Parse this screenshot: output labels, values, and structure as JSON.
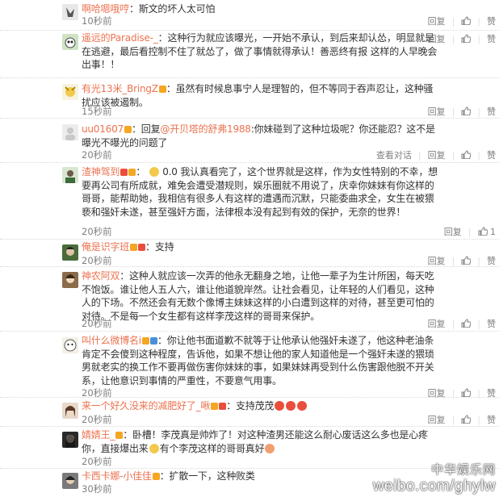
{
  "comments": [
    {
      "user": "啊哈嗯哦哼",
      "badges": [],
      "reply_to": "",
      "text": "：斯文的坏人太可怕",
      "time": "10秒前",
      "actions": [
        "回复",
        "赞"
      ],
      "like_count": ""
    },
    {
      "user": "遥远的Paradise-_",
      "badges": [],
      "reply_to": "",
      "text": "：这种行为就应该曝光，一开始不承认，到后来却认怂，明显就是在逃避，最后看控制不住了就怂了，做了事情就得承认！善恶终有报 这样的人早晚会出事！！",
      "time": "10秒前",
      "actions": [
        "回复",
        "赞"
      ],
      "like_count": ""
    },
    {
      "user": "有光13米_BringZ",
      "badges": [
        "#f5a623"
      ],
      "reply_to": "",
      "text": "：虽然有时候息事宁人是理智的，但不等同于吞声忍让，这种骚扰应该被遏制。",
      "time": "15秒前",
      "actions": [
        "回复",
        "赞"
      ],
      "like_count": ""
    },
    {
      "user": "uu01607",
      "badges": [
        "#f5a623"
      ],
      "reply_to": "@开贝塔的舒弗1988",
      "text": ":你妹碰到了这种垃圾呢？你还能忍？这不是曝光不曝光的问题了",
      "time": "20秒前",
      "actions": [
        "查看对话",
        "回复",
        "赞"
      ],
      "like_count": ""
    },
    {
      "user": "渣神驾到",
      "badges": [
        "#e94e3c",
        "#f5a623"
      ],
      "reply_to": "",
      "text": "0.0 我认真看完了，这个世界就是这样，作为女性特别的不幸，想要再公司有所成就，难免会遭受潜规则，娱乐圈就不用说了，庆幸你妹妹有你这样的哥哥，能帮助她，我相信有很多人有这样的遭遇而沉默，只能委曲求全，女生在被猥亵和强奸未遂，甚至强奸方面，法律根本没有起到有效的保护，无奈的世界！",
      "time": "20秒前",
      "actions": [
        "回复",
        "赞"
      ],
      "like_count": "1"
    },
    {
      "user": "俺是识字班",
      "badges": [
        "#f5a623",
        "#e94e3c"
      ],
      "reply_to": "",
      "text": "：支持",
      "time": "20秒前",
      "actions": [
        "回复",
        "赞"
      ],
      "like_count": ""
    },
    {
      "user": "神农阿双",
      "badges": [],
      "reply_to": "",
      "text": "：这种人就应该一次弄的他永无翻身之地，让他一辈子为生计所困，每天吃不饱饭。谁让他人五人六，谁让他道貌岸然。让社会看见，让年轻的人们看见，这种人的下场。不然还会有无数个像博主妹妹这样的小白遭到这样的对待，甚至更可怕的对待。不是每一个女生都有这样李茂这样的哥哥来保护。",
      "time": "20秒前",
      "actions": [
        "回复",
        "赞"
      ],
      "like_count": ""
    },
    {
      "user": "叫什么微博名i",
      "badges": [
        "#f5a623",
        "#4a90d9"
      ],
      "reply_to": "",
      "text": "：你让他书面道歉不就等于让他承认他强奸未遂了，他这种老油条肯定不会傻到这种程度，告诉他，如果不想让他的家人知道他是一个强奸未遂的猥琐男就老实的换工作不要再做伤害你妹妹的事，如果妹妹再受到什么伤害跟他脱不开关系，让他意识到事情的严重性，不要意气用事。",
      "time": "20秒前",
      "actions": [
        "回复",
        "赞"
      ],
      "like_count": ""
    },
    {
      "user": "来一个好久没来的减肥好了_啾",
      "badges": [
        "#f5a623",
        "#e94e3c"
      ],
      "reply_to": "",
      "text": "：支持茂茂",
      "time": "20秒前",
      "actions": [
        "回复",
        "赞"
      ],
      "like_count": ""
    },
    {
      "user": "婧婧王_",
      "badges": [
        "#f5a623"
      ],
      "reply_to": "",
      "text": "：卧槽！李茂真是帅炸了！对这种渣男还能这么耐心废话这么多也是心疼你，直接爆出来",
      "text2": "有个李茂这样的哥哥真好",
      "time": "20秒前",
      "actions": [
        "回复",
        "赞"
      ],
      "like_count": ""
    },
    {
      "user": "卡西卡娜-小佳佳",
      "badges": [
        "#f5a623"
      ],
      "reply_to": "",
      "text": "：扩散一下，这种败类",
      "time": "30秒前",
      "actions": [
        "回复",
        "赞"
      ],
      "like_count": ""
    }
  ],
  "watermark": {
    "line1": "中华娱乐网",
    "line2": "weibo.com/ghylw"
  },
  "colors": {
    "username": "#eb7350",
    "time": "#808080",
    "text": "#333333"
  }
}
